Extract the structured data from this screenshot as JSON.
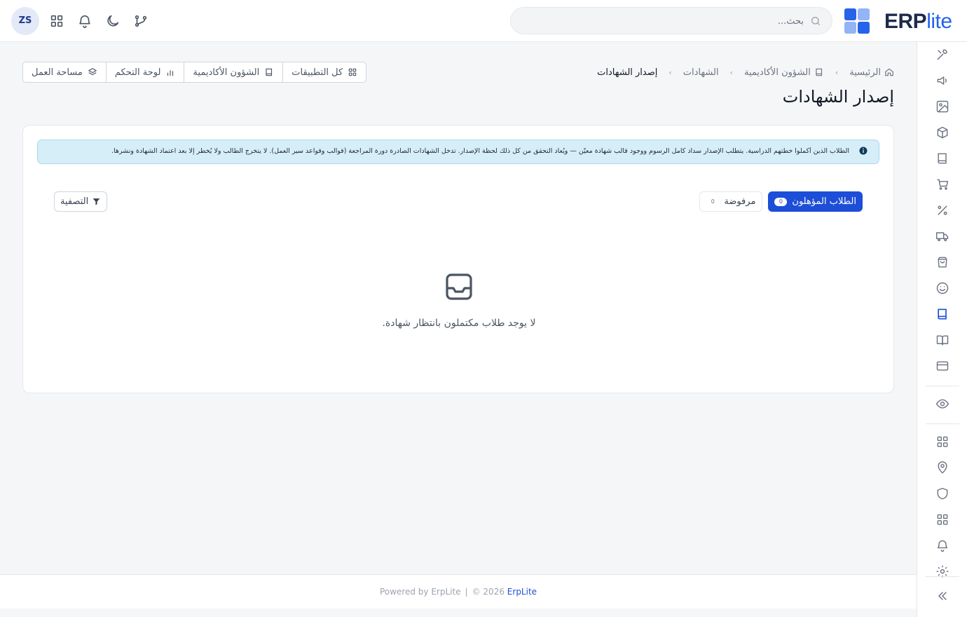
{
  "header": {
    "avatar_initials": "ZS",
    "search_placeholder": "بحث...",
    "logo_erp": "ERP",
    "logo_lite": "lite"
  },
  "breadcrumb": {
    "items": [
      "الرئيسية",
      "الشؤون الأكاديمية",
      "الشهادات",
      "إصدار الشهادات"
    ]
  },
  "quick_tabs": [
    "كل التطبيقات",
    "الشؤون الأكاديمية",
    "لوحة التحكم",
    "مساحة العمل"
  ],
  "page": {
    "title": "إصدار الشهادات",
    "alert": "الطلاب الذين أكملوا خطتهم الدراسية. يتطلب الإصدار سداد كامل الرسوم ووجود قالب شهادة معيّن — ويُعاد التحقق من كل ذلك لحظة الإصدار. تدخل الشهادات الصادرة دورة المراجعة (قوالب وقواعد سير العمل). لا يتخرج الطالب ولا يُخطر إلا بعد اعتماد الشهادة ونشرها.",
    "tabs": [
      {
        "label": "الطلاب المؤهلون",
        "count": "0",
        "active": true
      },
      {
        "label": "مرفوضة",
        "count": "0",
        "active": false
      }
    ],
    "filter_label": "التصفية",
    "empty_text": "لا يوجد طلاب مكتملون بانتظار شهادة."
  },
  "footer": {
    "brand": "ErpLite",
    "year_text": "© 2026",
    "powered_by": "Powered by ErpLite"
  },
  "rail_icons": [
    "tools-icon",
    "megaphone-icon",
    "image-icon",
    "box-icon",
    "book-icon",
    "cart-icon",
    "percent-icon",
    "truck-icon",
    "shopping-bag-icon",
    "smile-icon",
    "book-active-icon",
    "open-book-icon",
    "credit-card-icon",
    "eye-icon",
    "grid-icon",
    "map-pin-icon",
    "shield-icon",
    "apps-icon",
    "bell-icon",
    "settings-icon",
    "collapse-icon"
  ],
  "colors": {
    "primary": "#1d4ed8",
    "alert_bg": "#d6eef8",
    "brand_dark": "#1e2a4a"
  }
}
